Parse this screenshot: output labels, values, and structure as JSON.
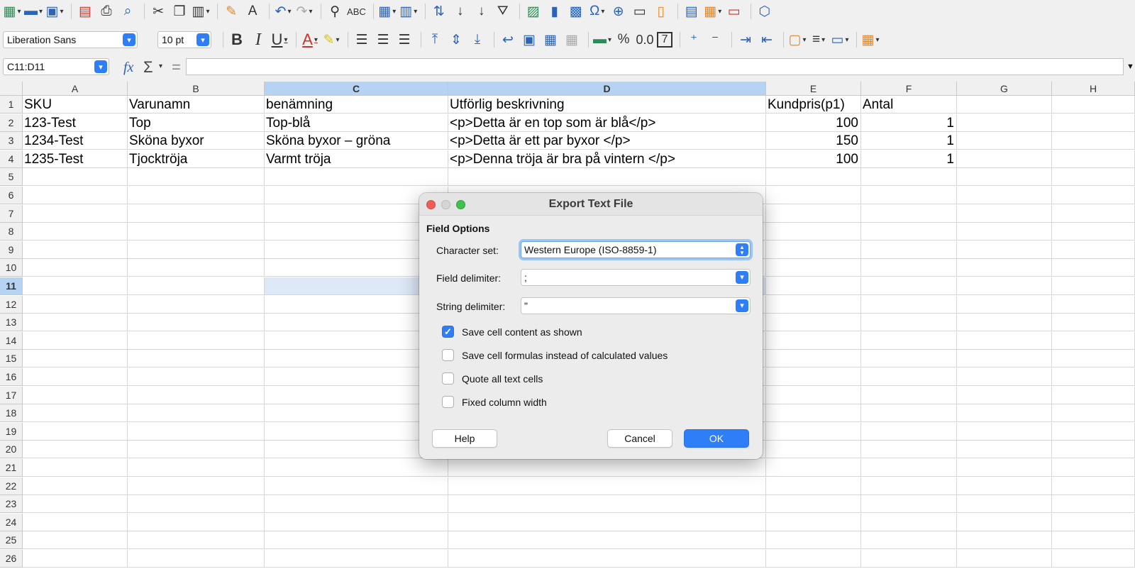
{
  "toolbar": {
    "font_name": "Liberation Sans",
    "font_size": "10 pt",
    "spelling_label": "ABC",
    "percent_label": "%",
    "decimal_label": "0.0",
    "seven_label": "7"
  },
  "formula_bar": {
    "name_box": "C11:D11",
    "fx": "fx",
    "sum": "Σ",
    "equals": "=",
    "content": ""
  },
  "columns": [
    "A",
    "B",
    "C",
    "D",
    "E",
    "F",
    "G",
    "H"
  ],
  "selected_columns": [
    "C",
    "D"
  ],
  "rows": [
    "1",
    "2",
    "3",
    "4",
    "5",
    "6",
    "7",
    "8",
    "9",
    "10",
    "11",
    "12",
    "13",
    "14",
    "15",
    "16",
    "17",
    "18",
    "19",
    "20",
    "21",
    "22",
    "23",
    "24",
    "25",
    "26"
  ],
  "selected_row": "11",
  "sheet": [
    [
      "SKU",
      "Varunamn",
      "benämning",
      "Utförlig beskrivning",
      "Kundpris(p1)",
      "Antal"
    ],
    [
      "123-Test",
      "Top",
      "Top-blå",
      "<p>Detta är en top som är blå</p>",
      "100",
      "1"
    ],
    [
      "1234-Test",
      "Sköna byxor",
      "Sköna byxor – gröna",
      "<p>Detta är ett par byxor </p>",
      "150",
      "1"
    ],
    [
      "1235-Test",
      "Tjocktröja",
      "Varmt tröja",
      "<p>Denna tröja är bra på vintern </p>",
      "100",
      "1"
    ]
  ],
  "dialog": {
    "title": "Export Text File",
    "section": "Field Options",
    "charset_label": "Character set:",
    "charset_value": "Western Europe (ISO-8859-1)",
    "field_delim_label": "Field delimiter:",
    "field_delim_value": ";",
    "string_delim_label": "String delimiter:",
    "string_delim_value": "\"",
    "options": [
      {
        "label": "Save cell content as shown",
        "checked": true
      },
      {
        "label": "Save cell formulas instead of calculated values",
        "checked": false
      },
      {
        "label": "Quote all text cells",
        "checked": false
      },
      {
        "label": "Fixed column width",
        "checked": false
      }
    ],
    "help": "Help",
    "cancel": "Cancel",
    "ok": "OK"
  },
  "colors": {
    "accent": "#2d7ef7",
    "selection_header": "#b7d3f4",
    "selection_cell": "#dde9f7"
  }
}
